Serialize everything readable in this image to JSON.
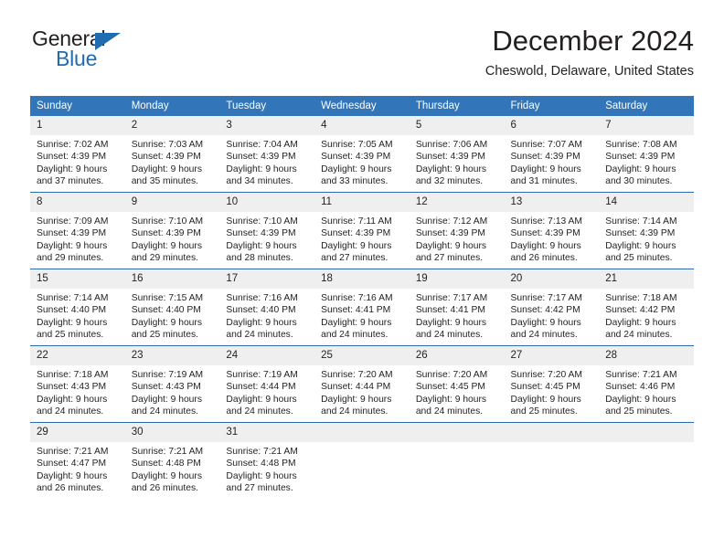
{
  "brand": {
    "name_top": "General",
    "name_bottom": "Blue",
    "triangle_color": "#1f6cb0"
  },
  "header": {
    "title": "December 2024",
    "subtitle": "Cheswold, Delaware, United States"
  },
  "theme": {
    "header_bg": "#3275b8",
    "week_divider": "#2e6da8",
    "daynum_bg": "#efefef",
    "text": "#231f20"
  },
  "weekday_headers": [
    "Sunday",
    "Monday",
    "Tuesday",
    "Wednesday",
    "Thursday",
    "Friday",
    "Saturday"
  ],
  "weeks": [
    [
      {
        "day": "1",
        "sunrise": "Sunrise: 7:02 AM",
        "sunset": "Sunset: 4:39 PM",
        "daylight_line1": "Daylight: 9 hours",
        "daylight_line2": "and 37 minutes."
      },
      {
        "day": "2",
        "sunrise": "Sunrise: 7:03 AM",
        "sunset": "Sunset: 4:39 PM",
        "daylight_line1": "Daylight: 9 hours",
        "daylight_line2": "and 35 minutes."
      },
      {
        "day": "3",
        "sunrise": "Sunrise: 7:04 AM",
        "sunset": "Sunset: 4:39 PM",
        "daylight_line1": "Daylight: 9 hours",
        "daylight_line2": "and 34 minutes."
      },
      {
        "day": "4",
        "sunrise": "Sunrise: 7:05 AM",
        "sunset": "Sunset: 4:39 PM",
        "daylight_line1": "Daylight: 9 hours",
        "daylight_line2": "and 33 minutes."
      },
      {
        "day": "5",
        "sunrise": "Sunrise: 7:06 AM",
        "sunset": "Sunset: 4:39 PM",
        "daylight_line1": "Daylight: 9 hours",
        "daylight_line2": "and 32 minutes."
      },
      {
        "day": "6",
        "sunrise": "Sunrise: 7:07 AM",
        "sunset": "Sunset: 4:39 PM",
        "daylight_line1": "Daylight: 9 hours",
        "daylight_line2": "and 31 minutes."
      },
      {
        "day": "7",
        "sunrise": "Sunrise: 7:08 AM",
        "sunset": "Sunset: 4:39 PM",
        "daylight_line1": "Daylight: 9 hours",
        "daylight_line2": "and 30 minutes."
      }
    ],
    [
      {
        "day": "8",
        "sunrise": "Sunrise: 7:09 AM",
        "sunset": "Sunset: 4:39 PM",
        "daylight_line1": "Daylight: 9 hours",
        "daylight_line2": "and 29 minutes."
      },
      {
        "day": "9",
        "sunrise": "Sunrise: 7:10 AM",
        "sunset": "Sunset: 4:39 PM",
        "daylight_line1": "Daylight: 9 hours",
        "daylight_line2": "and 29 minutes."
      },
      {
        "day": "10",
        "sunrise": "Sunrise: 7:10 AM",
        "sunset": "Sunset: 4:39 PM",
        "daylight_line1": "Daylight: 9 hours",
        "daylight_line2": "and 28 minutes."
      },
      {
        "day": "11",
        "sunrise": "Sunrise: 7:11 AM",
        "sunset": "Sunset: 4:39 PM",
        "daylight_line1": "Daylight: 9 hours",
        "daylight_line2": "and 27 minutes."
      },
      {
        "day": "12",
        "sunrise": "Sunrise: 7:12 AM",
        "sunset": "Sunset: 4:39 PM",
        "daylight_line1": "Daylight: 9 hours",
        "daylight_line2": "and 27 minutes."
      },
      {
        "day": "13",
        "sunrise": "Sunrise: 7:13 AM",
        "sunset": "Sunset: 4:39 PM",
        "daylight_line1": "Daylight: 9 hours",
        "daylight_line2": "and 26 minutes."
      },
      {
        "day": "14",
        "sunrise": "Sunrise: 7:14 AM",
        "sunset": "Sunset: 4:39 PM",
        "daylight_line1": "Daylight: 9 hours",
        "daylight_line2": "and 25 minutes."
      }
    ],
    [
      {
        "day": "15",
        "sunrise": "Sunrise: 7:14 AM",
        "sunset": "Sunset: 4:40 PM",
        "daylight_line1": "Daylight: 9 hours",
        "daylight_line2": "and 25 minutes."
      },
      {
        "day": "16",
        "sunrise": "Sunrise: 7:15 AM",
        "sunset": "Sunset: 4:40 PM",
        "daylight_line1": "Daylight: 9 hours",
        "daylight_line2": "and 25 minutes."
      },
      {
        "day": "17",
        "sunrise": "Sunrise: 7:16 AM",
        "sunset": "Sunset: 4:40 PM",
        "daylight_line1": "Daylight: 9 hours",
        "daylight_line2": "and 24 minutes."
      },
      {
        "day": "18",
        "sunrise": "Sunrise: 7:16 AM",
        "sunset": "Sunset: 4:41 PM",
        "daylight_line1": "Daylight: 9 hours",
        "daylight_line2": "and 24 minutes."
      },
      {
        "day": "19",
        "sunrise": "Sunrise: 7:17 AM",
        "sunset": "Sunset: 4:41 PM",
        "daylight_line1": "Daylight: 9 hours",
        "daylight_line2": "and 24 minutes."
      },
      {
        "day": "20",
        "sunrise": "Sunrise: 7:17 AM",
        "sunset": "Sunset: 4:42 PM",
        "daylight_line1": "Daylight: 9 hours",
        "daylight_line2": "and 24 minutes."
      },
      {
        "day": "21",
        "sunrise": "Sunrise: 7:18 AM",
        "sunset": "Sunset: 4:42 PM",
        "daylight_line1": "Daylight: 9 hours",
        "daylight_line2": "and 24 minutes."
      }
    ],
    [
      {
        "day": "22",
        "sunrise": "Sunrise: 7:18 AM",
        "sunset": "Sunset: 4:43 PM",
        "daylight_line1": "Daylight: 9 hours",
        "daylight_line2": "and 24 minutes."
      },
      {
        "day": "23",
        "sunrise": "Sunrise: 7:19 AM",
        "sunset": "Sunset: 4:43 PM",
        "daylight_line1": "Daylight: 9 hours",
        "daylight_line2": "and 24 minutes."
      },
      {
        "day": "24",
        "sunrise": "Sunrise: 7:19 AM",
        "sunset": "Sunset: 4:44 PM",
        "daylight_line1": "Daylight: 9 hours",
        "daylight_line2": "and 24 minutes."
      },
      {
        "day": "25",
        "sunrise": "Sunrise: 7:20 AM",
        "sunset": "Sunset: 4:44 PM",
        "daylight_line1": "Daylight: 9 hours",
        "daylight_line2": "and 24 minutes."
      },
      {
        "day": "26",
        "sunrise": "Sunrise: 7:20 AM",
        "sunset": "Sunset: 4:45 PM",
        "daylight_line1": "Daylight: 9 hours",
        "daylight_line2": "and 24 minutes."
      },
      {
        "day": "27",
        "sunrise": "Sunrise: 7:20 AM",
        "sunset": "Sunset: 4:45 PM",
        "daylight_line1": "Daylight: 9 hours",
        "daylight_line2": "and 25 minutes."
      },
      {
        "day": "28",
        "sunrise": "Sunrise: 7:21 AM",
        "sunset": "Sunset: 4:46 PM",
        "daylight_line1": "Daylight: 9 hours",
        "daylight_line2": "and 25 minutes."
      }
    ],
    [
      {
        "day": "29",
        "sunrise": "Sunrise: 7:21 AM",
        "sunset": "Sunset: 4:47 PM",
        "daylight_line1": "Daylight: 9 hours",
        "daylight_line2": "and 26 minutes."
      },
      {
        "day": "30",
        "sunrise": "Sunrise: 7:21 AM",
        "sunset": "Sunset: 4:48 PM",
        "daylight_line1": "Daylight: 9 hours",
        "daylight_line2": "and 26 minutes."
      },
      {
        "day": "31",
        "sunrise": "Sunrise: 7:21 AM",
        "sunset": "Sunset: 4:48 PM",
        "daylight_line1": "Daylight: 9 hours",
        "daylight_line2": "and 27 minutes."
      },
      {
        "day": "",
        "sunrise": "",
        "sunset": "",
        "daylight_line1": "",
        "daylight_line2": ""
      },
      {
        "day": "",
        "sunrise": "",
        "sunset": "",
        "daylight_line1": "",
        "daylight_line2": ""
      },
      {
        "day": "",
        "sunrise": "",
        "sunset": "",
        "daylight_line1": "",
        "daylight_line2": ""
      },
      {
        "day": "",
        "sunrise": "",
        "sunset": "",
        "daylight_line1": "",
        "daylight_line2": ""
      }
    ]
  ]
}
